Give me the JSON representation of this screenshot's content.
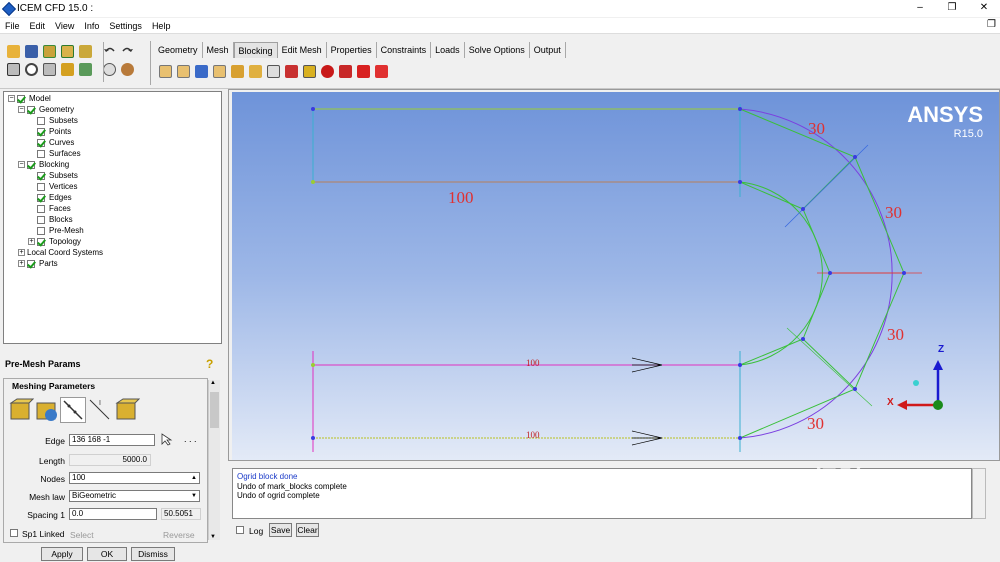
{
  "window": {
    "title": "ICEM CFD 15.0 :",
    "controls": [
      "–",
      "❐",
      "✕"
    ]
  },
  "menu": [
    "File",
    "Edit",
    "View",
    "Info",
    "Settings",
    "Help"
  ],
  "tabs": [
    "Geometry",
    "Mesh",
    "Blocking",
    "Edit Mesh",
    "Properties",
    "Constraints",
    "Loads",
    "Solve Options",
    "Output"
  ],
  "active_tab": "Blocking",
  "tree": [
    {
      "label": "Model",
      "level": 0,
      "expand": "−",
      "checked": true
    },
    {
      "label": "Geometry",
      "level": 1,
      "expand": "−",
      "checked": true
    },
    {
      "label": "Subsets",
      "level": 2,
      "checked": false
    },
    {
      "label": "Points",
      "level": 2,
      "checked": true
    },
    {
      "label": "Curves",
      "level": 2,
      "checked": true
    },
    {
      "label": "Surfaces",
      "level": 2,
      "checked": false
    },
    {
      "label": "Blocking",
      "level": 1,
      "expand": "−",
      "checked": true
    },
    {
      "label": "Subsets",
      "level": 2,
      "checked": true
    },
    {
      "label": "Vertices",
      "level": 2,
      "checked": false
    },
    {
      "label": "Edges",
      "level": 2,
      "checked": true
    },
    {
      "label": "Faces",
      "level": 2,
      "checked": false
    },
    {
      "label": "Blocks",
      "level": 2,
      "checked": false
    },
    {
      "label": "Pre-Mesh",
      "level": 2,
      "checked": false
    },
    {
      "label": "Topology",
      "level": 2,
      "expand": "+",
      "checked": true
    },
    {
      "label": "Local Coord Systems",
      "level": 1,
      "expand": "+",
      "checked": null
    },
    {
      "label": "Parts",
      "level": 1,
      "expand": "+",
      "checked": true
    }
  ],
  "params": {
    "header": "Pre-Mesh Params",
    "group_title": "Meshing Parameters",
    "edge_label": "Edge",
    "edge_value": "136 168 -1",
    "edge_more": ". . .",
    "length_label": "Length",
    "length_value": "5000.0",
    "nodes_label": "Nodes",
    "nodes_value": "100",
    "meshlaw_label": "Mesh law",
    "meshlaw_value": "BiGeometric",
    "spacing1_label": "Spacing 1",
    "spacing1_value": "0.0",
    "spacing1_calc": "50.5051",
    "sp1linked_label": "Sp1 Linked",
    "select_label": "Select",
    "reverse_label": "Reverse",
    "apply": "Apply",
    "ok": "OK",
    "dismiss": "Dismiss"
  },
  "viewport": {
    "logo": "ANSYS",
    "version": "R15.0",
    "labels": [
      "100",
      "30",
      "30",
      "30",
      "30",
      "100",
      "100"
    ],
    "axes": {
      "z": "Z",
      "x": "X"
    }
  },
  "messages": [
    "Ogrid block done",
    "Undo of mark_blocks complete",
    "Undo of ogrid complete"
  ],
  "message_controls": {
    "log": "Log",
    "save": "Save",
    "clear": "Clear"
  },
  "watermark": {
    "text": "Bai 经验",
    "url": "jingyan.baidu.com"
  }
}
